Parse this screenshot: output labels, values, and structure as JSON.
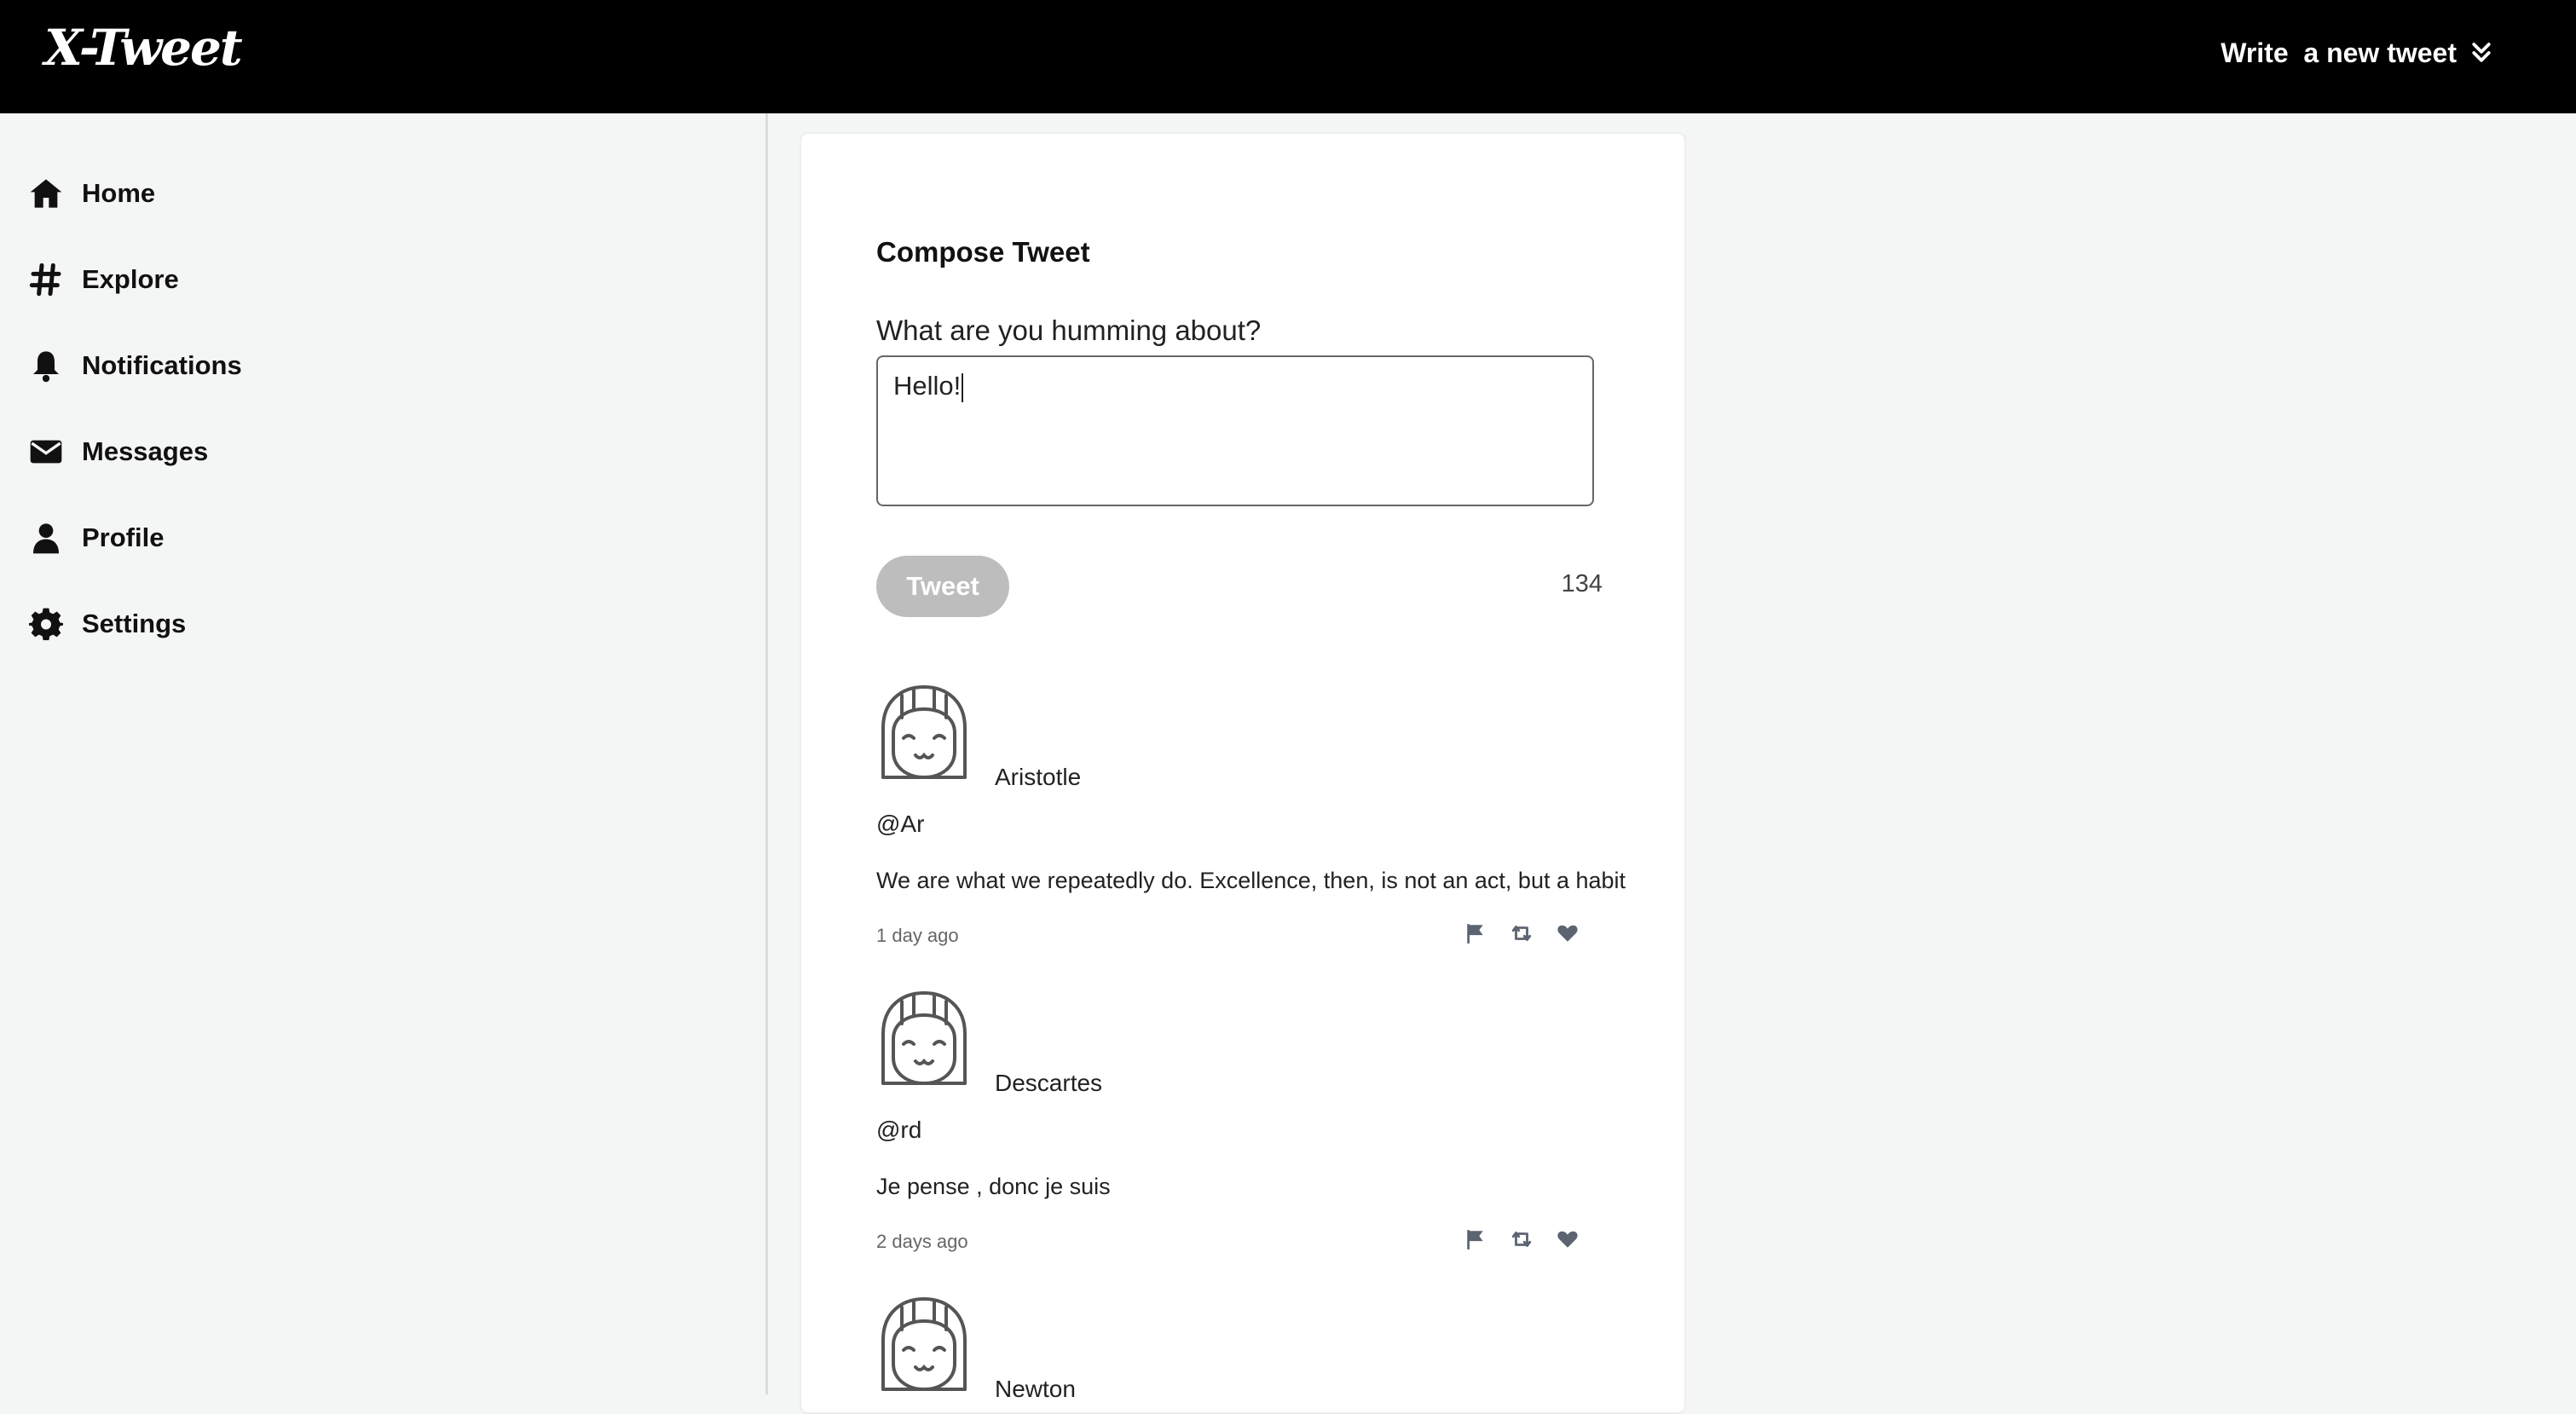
{
  "header": {
    "logo": "X-Tweet",
    "write_label": "Write  a new tweet",
    "write_icon": "double-chevron-down-icon"
  },
  "sidebar": {
    "items": [
      {
        "label": "Home",
        "icon": "home-icon"
      },
      {
        "label": "Explore",
        "icon": "hashtag-icon"
      },
      {
        "label": "Notifications",
        "icon": "bell-icon"
      },
      {
        "label": "Messages",
        "icon": "envelope-icon"
      },
      {
        "label": "Profile",
        "icon": "user-icon"
      },
      {
        "label": "Settings",
        "icon": "gear-icon"
      }
    ]
  },
  "compose": {
    "title": "Compose Tweet",
    "prompt": "What are you humming about?",
    "value": "Hello!",
    "tweet_label": "Tweet",
    "remaining": "134"
  },
  "tweets": [
    {
      "name": "Aristotle",
      "handle": "@Ar",
      "text": "We are what we repeatedly do. Excellence, then, is not an act, but a habit",
      "time": "1 day ago"
    },
    {
      "name": "Descartes",
      "handle": "@rd",
      "text": "Je pense , donc je suis",
      "time": "2 days ago"
    },
    {
      "name": "Newton",
      "handle": "",
      "text": "",
      "time": ""
    }
  ],
  "colors": {
    "topbar": "#000000",
    "sidebar_bg": "#f4f6f5",
    "tweet_button_disabled": "#bdbdbd",
    "action_icon": "#5b6470"
  }
}
